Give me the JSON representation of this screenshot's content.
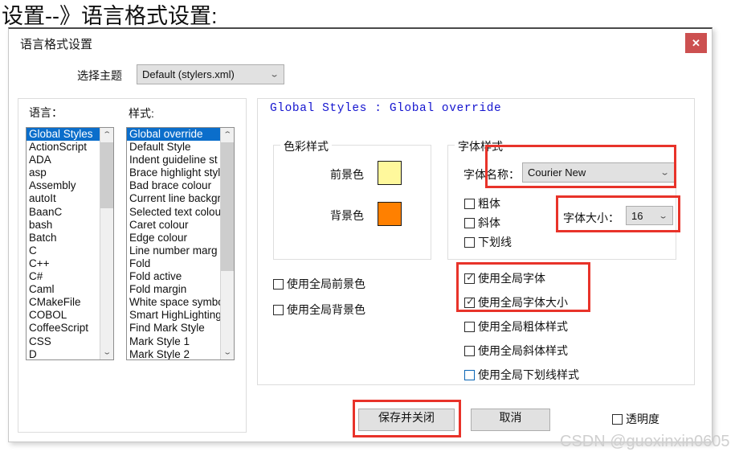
{
  "page": {
    "heading": "设置--》语言格式设置:",
    "watermark": "CSDN @guoxinxin0605"
  },
  "dialog": {
    "title": "语言格式设置",
    "close_label": "✕",
    "close_color": "#cc5050"
  },
  "theme": {
    "label": "选择主题",
    "value": "Default (stylers.xml)",
    "chevron": "⌄"
  },
  "language_list": {
    "label": "语言：",
    "selected": "Global Styles",
    "items": [
      "Global Styles",
      "ActionScript",
      "ADA",
      "asp",
      "Assembly",
      "autoIt",
      "BaanC",
      "bash",
      "Batch",
      "C",
      "C++",
      "C#",
      "Caml",
      "CMakeFile",
      "COBOL",
      "CoffeeScript",
      "CSS",
      "D"
    ],
    "scroll_up": "⌃",
    "scroll_down": "⌄"
  },
  "style_list": {
    "label": "样式:",
    "selected": "Global override",
    "items": [
      "Global override",
      "Default Style",
      "Indent guideline st",
      "Brace highlight styl",
      "Bad brace colour",
      "Current line backgr",
      "Selected text colou",
      "Caret colour",
      "Edge colour",
      "Line number marg",
      "Fold",
      "Fold active",
      "Fold margin",
      "White space symbo",
      "Smart HighLighting",
      "Find Mark Style",
      "Mark Style 1",
      "Mark Style 2"
    ],
    "scroll_up": "⌃",
    "scroll_down": "⌄"
  },
  "panel": {
    "header": "Global Styles : Global override",
    "header_color": "#1414cf"
  },
  "color_style": {
    "legend": "色彩样式",
    "foreground_label": "前景色",
    "foreground_color": "#fff89c",
    "background_label": "背景色",
    "background_color": "#ff8000",
    "use_global_fg": "使用全局前景色",
    "use_global_fg_checked": false,
    "use_global_bg": "使用全局背景色",
    "use_global_bg_checked": false
  },
  "font_style": {
    "legend": "字体样式",
    "font_name_label": "字体名称：",
    "font_name_value": "Courier New",
    "font_size_label": "字体大小：",
    "font_size_value": "16",
    "bold_label": "粗体",
    "bold_checked": false,
    "italic_label": "斜体",
    "italic_checked": false,
    "underline_label": "下划线",
    "underline_checked": false,
    "use_global_font": "使用全局字体",
    "use_global_font_checked": true,
    "use_global_font_size": "使用全局字体大小",
    "use_global_font_size_checked": true,
    "use_global_bold": "使用全局粗体样式",
    "use_global_bold_checked": false,
    "use_global_italic": "使用全局斜体样式",
    "use_global_italic_checked": false,
    "use_global_underline": "使用全局下划线样式",
    "use_global_underline_checked": false,
    "tick": "✓"
  },
  "footer": {
    "save_label": "保存并关闭",
    "cancel_label": "取消",
    "transparency_label": "透明度",
    "transparency_checked": false
  },
  "annotations": {
    "color": "#e8332a",
    "boxes": [
      "font-name-highlight",
      "font-size-highlight",
      "use-global-font-highlight",
      "save-button-highlight"
    ]
  }
}
